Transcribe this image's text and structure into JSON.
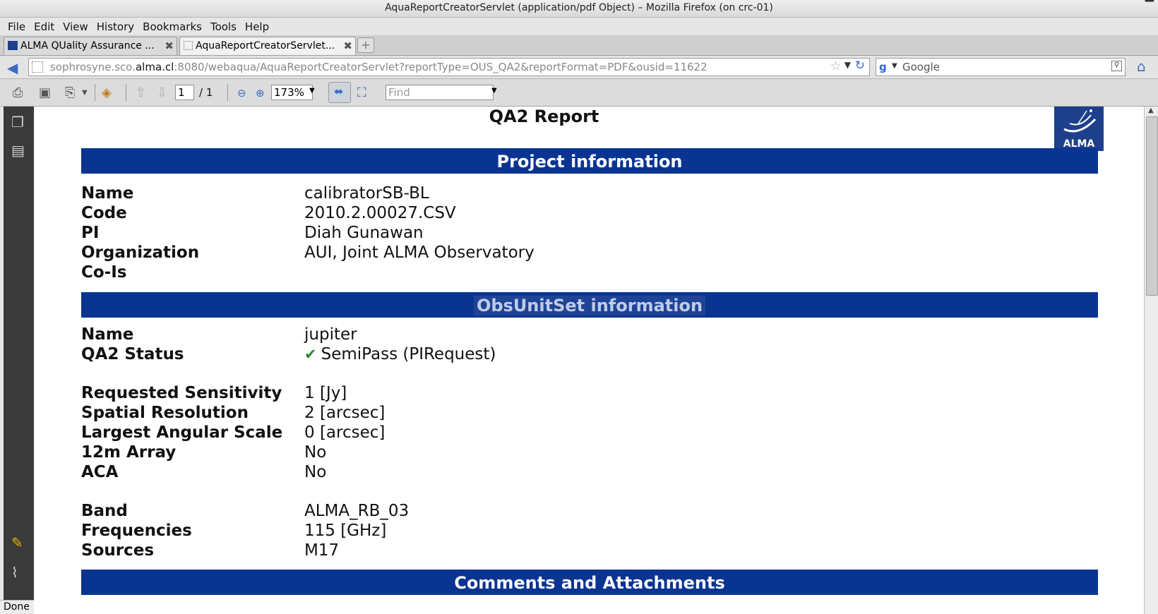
{
  "window": {
    "title": "AquaReportCreatorServlet (application/pdf Object) – Mozilla Firefox (on crc-01)"
  },
  "menu": [
    "File",
    "Edit",
    "View",
    "History",
    "Bookmarks",
    "Tools",
    "Help"
  ],
  "tabs": [
    {
      "label": "ALMA QUality Assurance ..."
    },
    {
      "label": "AquaReportCreatorServlet..."
    }
  ],
  "nav": {
    "url_host_pre": "sophrosyne.sco.",
    "url_host_domain": "alma.cl",
    "url_rest": ":8080/webaqua/AquaReportCreatorServlet?reportType=OUS_QA2&reportFormat=PDF&ousid=11622",
    "search_placeholder": "Google"
  },
  "pdf_toolbar": {
    "page_current": "1",
    "page_total": "/  1",
    "zoom": "173%",
    "find_placeholder": "Find"
  },
  "status": "Done",
  "report": {
    "title": "QA2 Report",
    "logo_text": "ALMA",
    "project_heading": "Project information",
    "project": [
      {
        "k": "Name",
        "v": "calibratorSB-BL"
      },
      {
        "k": "Code",
        "v": "2010.2.00027.CSV"
      },
      {
        "k": "PI",
        "v": "Diah Gunawan"
      },
      {
        "k": "Organization",
        "v": "AUI, Joint ALMA Observatory"
      },
      {
        "k": "Co-Is",
        "v": ""
      }
    ],
    "ous_heading": "ObsUnitSet information",
    "ous": [
      {
        "k": "Name",
        "v": "jupiter"
      },
      {
        "k": "QA2 Status",
        "v": "SemiPass (PIRequest)"
      }
    ],
    "requirements": [
      {
        "k": "Requested Sensitivity",
        "v": "1 [Jy]"
      },
      {
        "k": "Spatial Resolution",
        "v": "2 [arcsec]"
      },
      {
        "k": "Largest Angular Scale",
        "v": "0 [arcsec]"
      },
      {
        "k": "12m Array",
        "v": "No"
      },
      {
        "k": "ACA",
        "v": "No"
      }
    ],
    "spectral": [
      {
        "k": "Band",
        "v": "ALMA_RB_03"
      },
      {
        "k": "Frequencies",
        "v": "115 [GHz]"
      },
      {
        "k": "Sources",
        "v": "M17"
      }
    ],
    "comments_heading": "Comments and Attachments"
  }
}
